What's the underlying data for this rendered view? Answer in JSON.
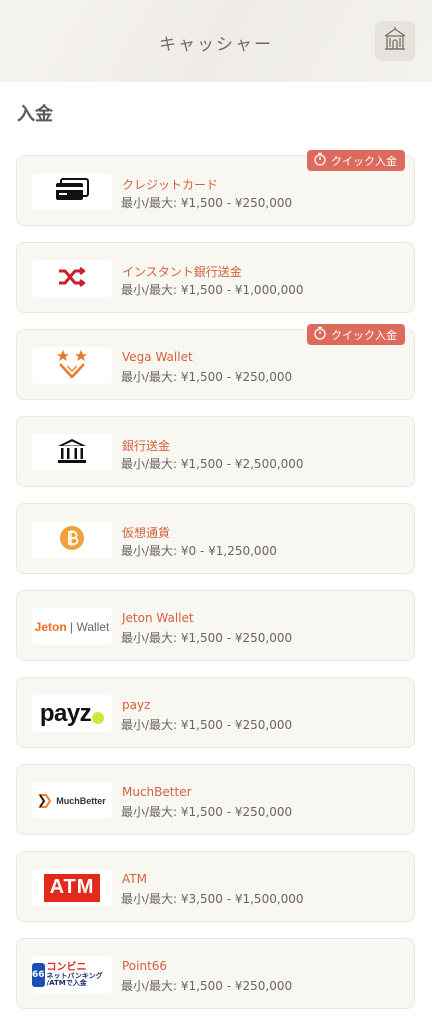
{
  "header": {
    "title": "キャッシャー",
    "home_icon": "temple-home-icon"
  },
  "section": {
    "title": "入金"
  },
  "badge_label": "クイック入金",
  "colors": {
    "accent": "#d5603f",
    "badge": "#dd6b5d",
    "card_bg": "#f9f7f2"
  },
  "methods": [
    {
      "name": "クレジットカード",
      "range": "最小/最大: ¥1,500 - ¥250,000",
      "quick": true,
      "icon": "credit-card-icon"
    },
    {
      "name": "インスタント銀行送金",
      "range": "最小/最大: ¥1,500 - ¥1,000,000",
      "quick": false,
      "icon": "shuffle-icon"
    },
    {
      "name": "Vega Wallet",
      "range": "最小/最大: ¥1,500 - ¥250,000",
      "quick": true,
      "icon": "vega-logo-icon"
    },
    {
      "name": "銀行送金",
      "range": "最小/最大: ¥1,500 - ¥2,500,000",
      "quick": false,
      "icon": "bank-icon"
    },
    {
      "name": "仮想通貨",
      "range": "最小/最大: ¥0 - ¥1,250,000",
      "quick": false,
      "icon": "bitcoin-icon"
    },
    {
      "name": "Jeton Wallet",
      "range": "最小/最大: ¥1,500 - ¥250,000",
      "quick": false,
      "icon": "jeton-logo-icon",
      "logo_text": [
        "Jeton",
        "Wallet"
      ]
    },
    {
      "name": "payz",
      "range": "最小/最大: ¥1,500 - ¥250,000",
      "quick": false,
      "icon": "payz-logo-icon",
      "logo_text": "payz"
    },
    {
      "name": "MuchBetter",
      "range": "最小/最大: ¥1,500 - ¥250,000",
      "quick": false,
      "icon": "muchbetter-logo-icon",
      "logo_text": "MuchBetter"
    },
    {
      "name": "ATM",
      "range": "最小/最大: ¥3,500 - ¥1,500,000",
      "quick": false,
      "icon": "atm-logo-icon",
      "logo_text": "ATM"
    },
    {
      "name": "Point66",
      "range": "最小/最大: ¥1,500 - ¥250,000",
      "quick": false,
      "icon": "point66-logo-icon",
      "logo_text": [
        "66",
        "コンビニ",
        "ネットバンキング /ATMで入金"
      ]
    }
  ]
}
